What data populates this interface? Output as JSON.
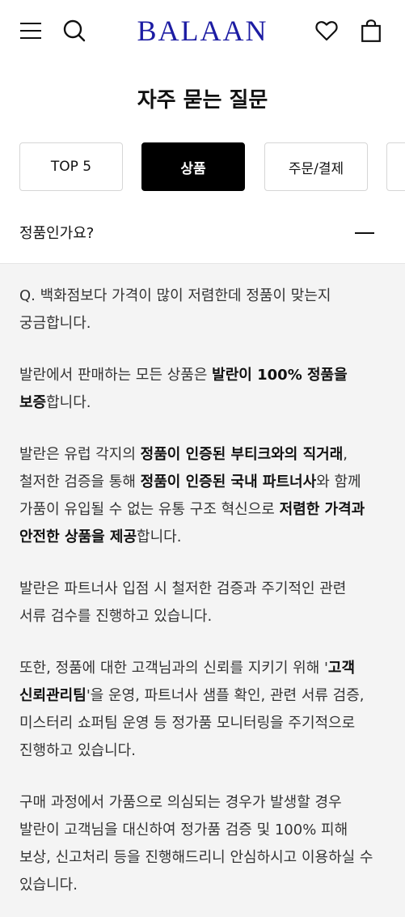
{
  "header": {
    "logo": "BALAAN",
    "menu_icon": "hamburger-menu-icon",
    "search_icon": "search-icon",
    "wishlist_icon": "heart-icon",
    "cart_icon": "shopping-bag-icon",
    "logo_color": "#1c1ca3"
  },
  "page": {
    "title": "자주 묻는 질문"
  },
  "tabs": [
    {
      "label": "TOP 5",
      "active": false
    },
    {
      "label": "상품",
      "active": true
    },
    {
      "label": "주문/결제",
      "active": false
    },
    {
      "label": "",
      "active": false
    }
  ],
  "question": {
    "title": "정품인가요?",
    "toggle_icon": "minus-icon"
  },
  "answer": {
    "p1": "Q. 백화점보다 가격이 많이 저렴한데 정품이 맞는지 궁금합니다.",
    "p2": [
      {
        "text": "발란에서 판매하는 모든 상품은 ",
        "bold": false
      },
      {
        "text": "발란이 100% 정품을 보증",
        "bold": true
      },
      {
        "text": "합니다.",
        "bold": false
      }
    ],
    "p3": [
      {
        "text": "발란은 유럽 각지의 ",
        "bold": false
      },
      {
        "text": "정품이 인증된 부티크와의 직거래",
        "bold": true
      },
      {
        "text": ", 철저한 검증을 통해 ",
        "bold": false
      },
      {
        "text": "정품이 인증된 국내 파트너사",
        "bold": true
      },
      {
        "text": "와 함께 가품이 유입될 수 없는 유통 구조 혁신으로 ",
        "bold": false
      },
      {
        "text": "저렴한 가격과 안전한 상품을 제공",
        "bold": true
      },
      {
        "text": "합니다.",
        "bold": false
      }
    ],
    "p4": "발란은 파트너사 입점 시 철저한 검증과 주기적인 관련 서류 검수를 진행하고 있습니다.",
    "p5": [
      {
        "text": "또한, 정품에 대한 고객님과의 신뢰를 지키기 위해 '",
        "bold": false
      },
      {
        "text": "고객 신뢰관리팀",
        "bold": true
      },
      {
        "text": "'을 운영, 파트너사 샘플 확인, 관련 서류 검증, 미스터리 쇼퍼팀 운영 등 정가품 모니터링을 주기적으로 진행하고 있습니다.",
        "bold": false
      }
    ],
    "p6": "구매 과정에서 가품으로 의심되는 경우가 발생할 경우 발란이 고객님을 대신하여 정가품 검증 및 100% 피해 보상, 신고처리 등을 진행해드리니 안심하시고 이용하실 수 있습니다."
  }
}
